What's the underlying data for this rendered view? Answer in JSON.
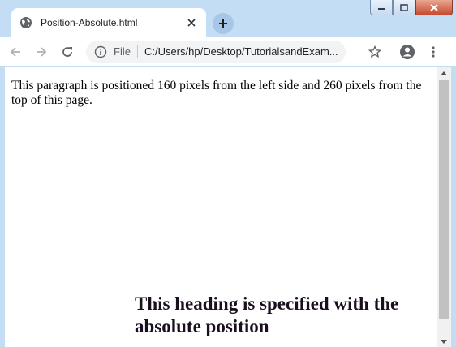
{
  "tab": {
    "title": "Position-Absolute.html"
  },
  "toolbar": {
    "scheme_label": "File",
    "url": "C:/Users/hp/Desktop/TutorialsandExam..."
  },
  "page": {
    "paragraph": "This paragraph is positioned 160 pixels from the left side and 260 pixels from the top of this page.",
    "heading": "This heading is specified with the absolute position"
  },
  "icons": {
    "tab_favicon": "globe-icon",
    "tab_close": "close-icon",
    "new_tab": "plus-icon",
    "back": "back-arrow-icon",
    "forward": "forward-arrow-icon",
    "reload": "reload-icon",
    "info": "info-icon",
    "bookmark": "star-icon",
    "profile": "profile-icon",
    "menu": "kebab-menu-icon"
  },
  "colors": {
    "frame": "#c3ddf5",
    "heading_text": "#1a0f1f"
  }
}
